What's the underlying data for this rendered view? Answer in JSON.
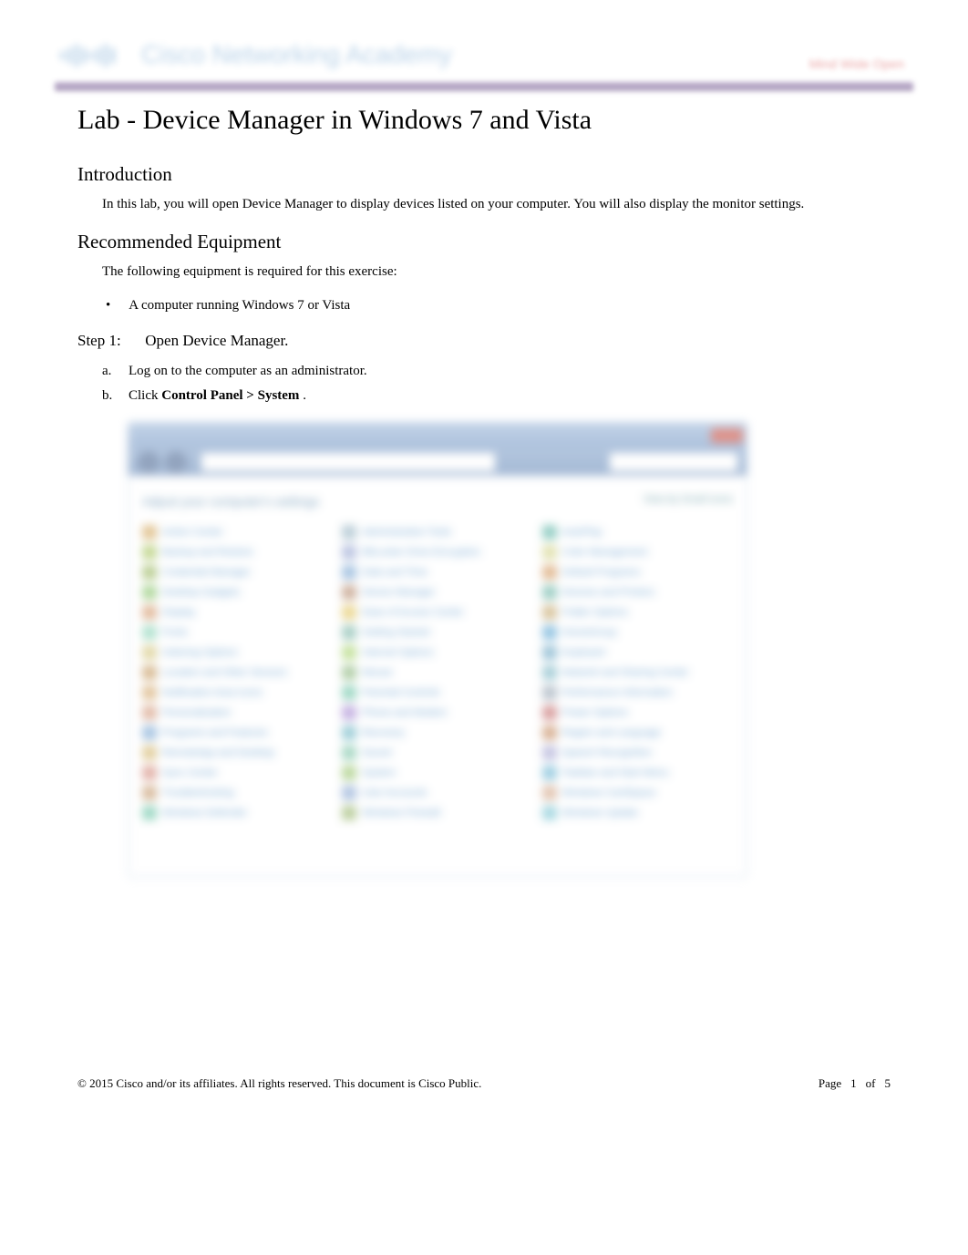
{
  "header": {
    "brand_text": "Cisco Networking Academy",
    "tagline": "Mind Wide Open"
  },
  "doc": {
    "title": "Lab - Device Manager in Windows 7 and Vista"
  },
  "intro": {
    "heading": "Introduction",
    "text": "In this lab, you will open Device Manager to display devices listed on your computer. You will also display the monitor settings."
  },
  "equipment": {
    "heading": "Recommended Equipment",
    "text": "The following equipment is required for this exercise:",
    "bullet": "A computer running Windows 7 or Vista"
  },
  "step1": {
    "label": "Step 1:",
    "title": "Open Device Manager.",
    "a": {
      "letter": "a.",
      "text": "Log on to the computer as an administrator."
    },
    "b": {
      "letter": "b.",
      "prefix": "Click ",
      "bold": "Control Panel > System",
      "suffix": "."
    }
  },
  "control_panel": {
    "heading": "Adjust your computer's settings",
    "view_label": "View by",
    "view_value": "Small Icons",
    "items": [
      "Action Center",
      "Administrative Tools",
      "AutoPlay",
      "Backup and Restore",
      "BitLocker Drive Encryption",
      "Color Management",
      "Credential Manager",
      "Date and Time",
      "Default Programs",
      "Desktop Gadgets",
      "Device Manager",
      "Devices and Printers",
      "Display",
      "Ease of Access Center",
      "Folder Options",
      "Fonts",
      "Getting Started",
      "HomeGroup",
      "Indexing Options",
      "Internet Options",
      "Keyboard",
      "Location and Other Sensors",
      "Mouse",
      "Network and Sharing Center",
      "Notification Area Icons",
      "Parental Controls",
      "Performance Information",
      "Personalization",
      "Phone and Modem",
      "Power Options",
      "Programs and Features",
      "Recovery",
      "Region and Language",
      "RemoteApp and Desktop",
      "Sound",
      "Speech Recognition",
      "Sync Center",
      "System",
      "Taskbar and Start Menu",
      "Troubleshooting",
      "User Accounts",
      "Windows CardSpace",
      "Windows Defender",
      "Windows Firewall",
      "Windows Update"
    ],
    "icon_colors": [
      "#c94",
      "#8ab",
      "#4a9",
      "#9b4",
      "#89c",
      "#cc7",
      "#8a4",
      "#69c",
      "#c84",
      "#7b5",
      "#a75",
      "#5a9",
      "#c85",
      "#db4",
      "#b95",
      "#7ca",
      "#6a9",
      "#49c",
      "#cb6",
      "#9c5",
      "#59b",
      "#b84",
      "#7a6",
      "#6ab",
      "#c95",
      "#5b9",
      "#89a",
      "#c86",
      "#97c",
      "#b55",
      "#69c",
      "#5ab",
      "#b74",
      "#ca5",
      "#6b9",
      "#99c",
      "#c76",
      "#8b5",
      "#5ac",
      "#b85",
      "#79c",
      "#c97",
      "#5b9",
      "#8a5",
      "#6bc"
    ]
  },
  "footer": {
    "copyright": "© 2015 Cisco and/or its affiliates. All rights reserved. This document is Cisco Public.",
    "page_label": "Page",
    "page_num": "1",
    "page_of": "of",
    "page_total": "5"
  }
}
